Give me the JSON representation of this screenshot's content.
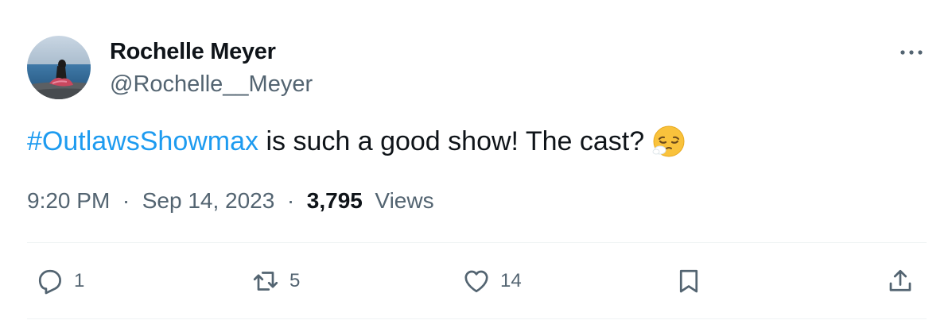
{
  "author": {
    "name": "Rochelle Meyer",
    "handle": "@Rochelle__Meyer"
  },
  "tweet": {
    "hashtag": "#OutlawsShowmax",
    "text": " is such a good show! The cast?",
    "emoji": "relieved-sigh-face-emoji"
  },
  "meta": {
    "time": "9:20 PM",
    "separator": "·",
    "date": "Sep 14, 2023",
    "views_count": "3,795",
    "views_label": "Views"
  },
  "actions": {
    "reply_count": "1",
    "retweet_count": "5",
    "like_count": "14"
  },
  "colors": {
    "accent": "#1d9bf0",
    "secondary_text": "#536471",
    "primary_text": "#0f1419",
    "divider": "#eff3f4"
  },
  "icons": [
    "more-icon",
    "reply-icon",
    "retweet-icon",
    "like-icon",
    "bookmark-icon",
    "share-icon"
  ]
}
